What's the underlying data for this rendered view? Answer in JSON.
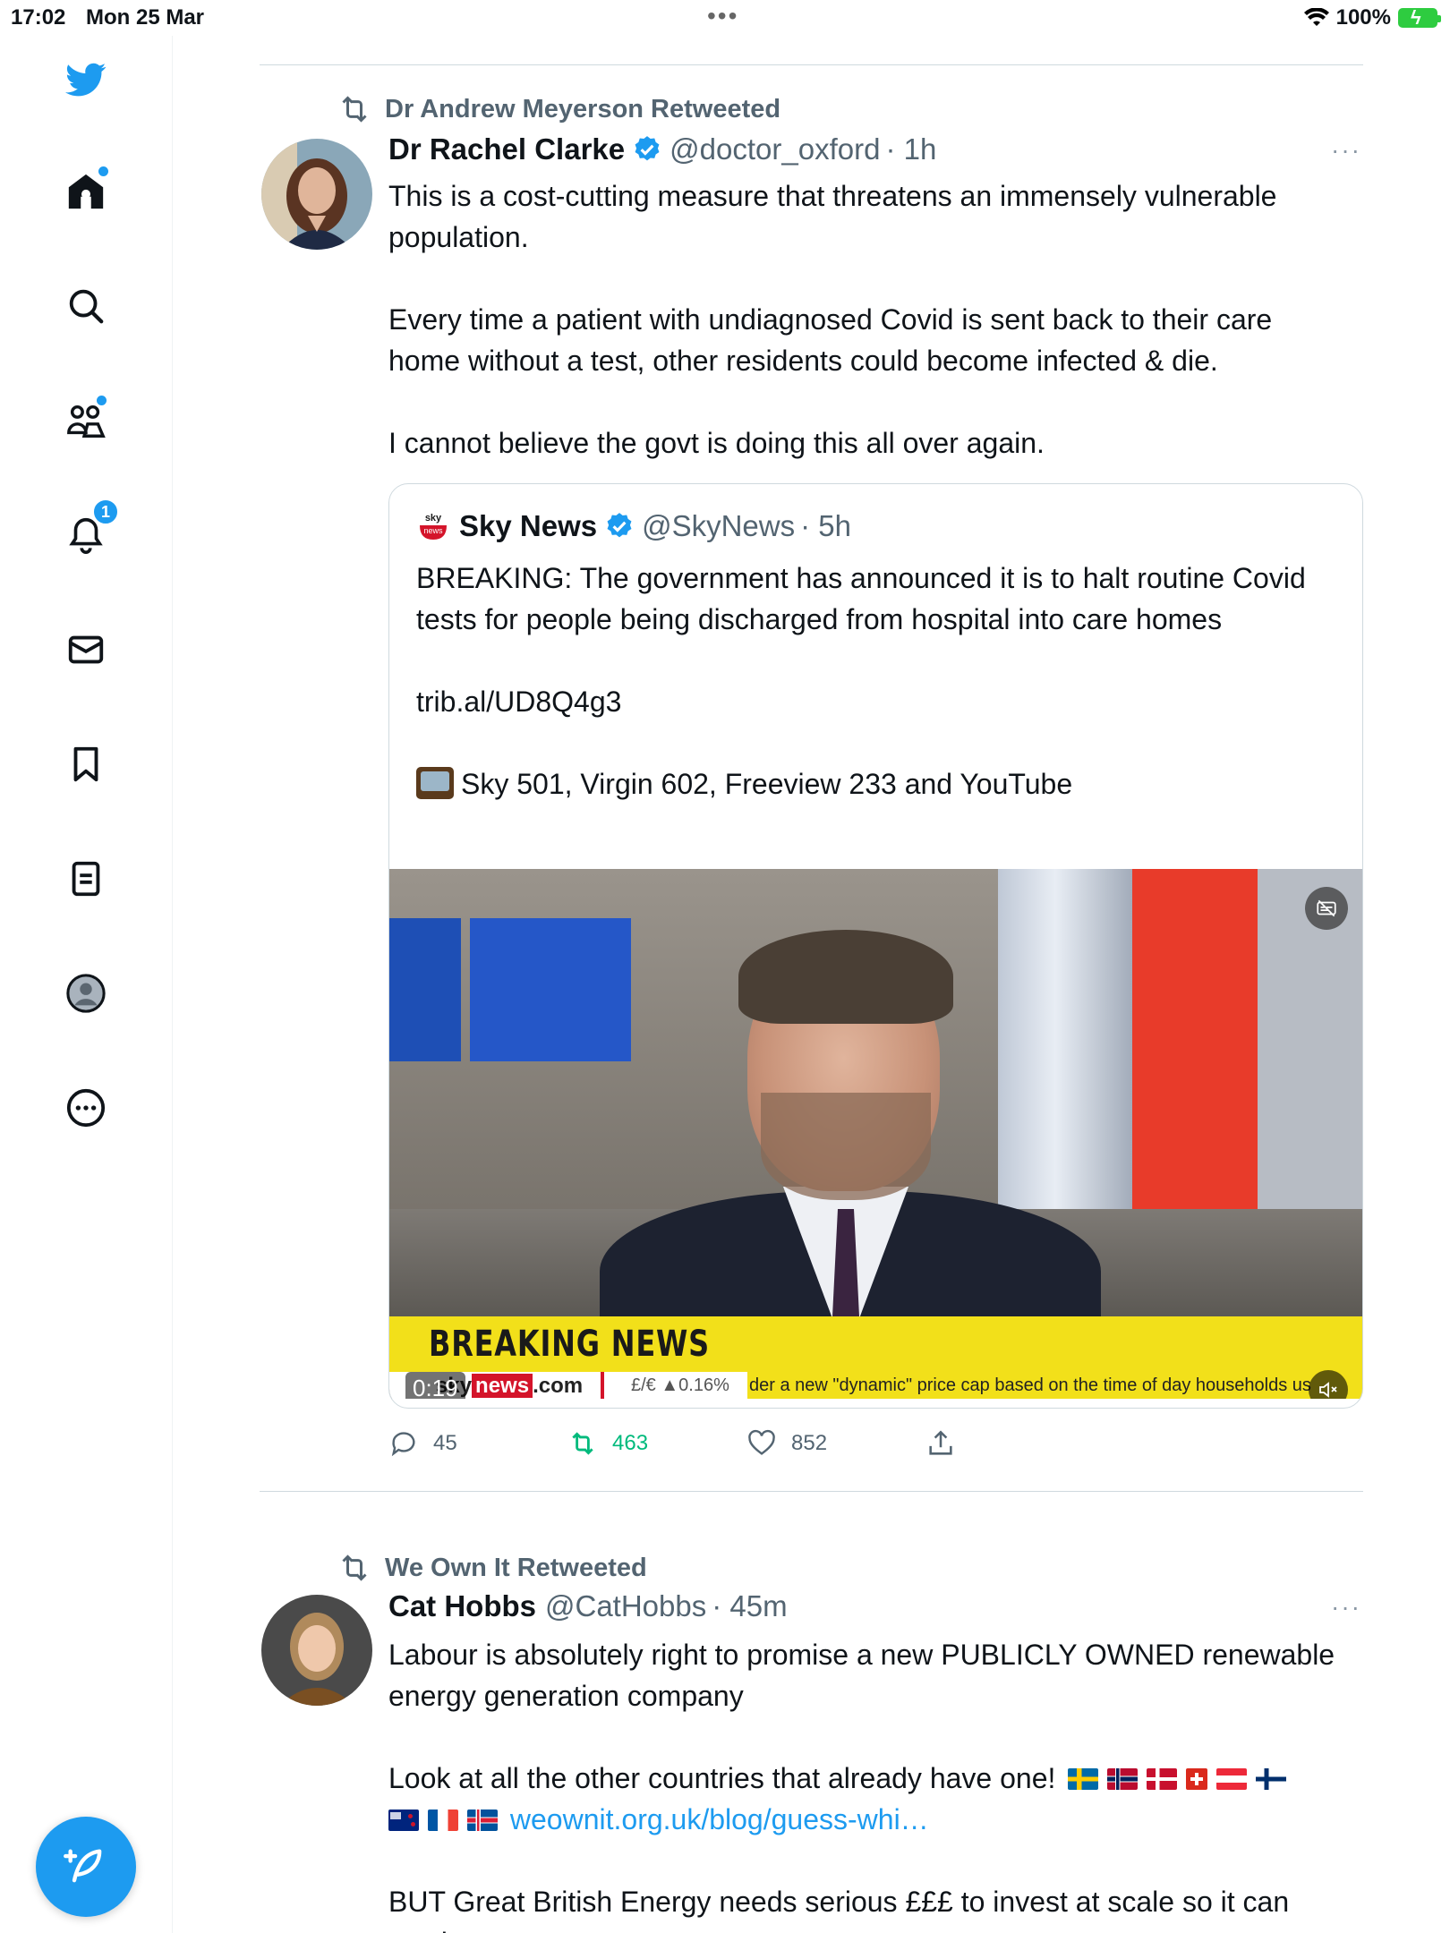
{
  "status_bar": {
    "time": "17:02",
    "date": "Mon 25 Mar",
    "battery": "100%"
  },
  "colors": {
    "brand": "#1d9bf0",
    "retweet_green": "#00ba7c",
    "secondary_text": "#536471"
  },
  "sidebar": {
    "items": [
      {
        "icon": "twitter-bird-icon"
      },
      {
        "icon": "home-icon",
        "has_dot": true
      },
      {
        "icon": "search-icon"
      },
      {
        "icon": "communities-icon",
        "has_dot": true
      },
      {
        "icon": "bell-icon",
        "badge": "1"
      },
      {
        "icon": "mail-icon"
      },
      {
        "icon": "bookmark-icon"
      },
      {
        "icon": "lists-icon"
      },
      {
        "icon": "profile-icon"
      },
      {
        "icon": "more-icon"
      }
    ],
    "compose_icon": "compose-feather-icon"
  },
  "tweet1": {
    "retweeted_by": "Dr Andrew Meyerson Retweeted",
    "name": "Dr Rachel Clarke",
    "handle": "@doctor_oxford",
    "time": "· 1h",
    "more": "···",
    "text": "This is a cost-cutting measure that threatens an immensely vulnerable population.\n\nEvery time a patient with undiagnosed Covid is sent back to their care home without a test, other residents could become infected & die.\n\nI cannot believe the govt is doing this all over again.",
    "quote": {
      "logo_top": "sky",
      "logo_bottom": "news",
      "name": "Sky News",
      "handle": "@SkyNews",
      "time": "· 5h",
      "text": "BREAKING: The government has announced it is to halt routine Covid tests for people being discharged from hospital into care homes\n\ntrib.al/UD8Q4g3\n\n",
      "tv_line": "Sky 501, Virgin 602, Freeview 233 and YouTube",
      "video": {
        "banner": "BREAKING NEWS",
        "ticker_site_prefix": "sky",
        "ticker_site_news": "news",
        "ticker_site_suffix": ".com",
        "ticker_fx": "£/€ ▲0.16%",
        "ticker_story": "der a new \"dynamic\" price cap based on the time of day households us",
        "elapsed": "0:19"
      }
    },
    "actions": {
      "replies": "45",
      "retweets": "463",
      "likes": "852"
    }
  },
  "tweet2": {
    "retweeted_by": "We Own It Retweeted",
    "name": "Cat Hobbs",
    "handle": "@CatHobbs",
    "time": "· 45m",
    "more": "···",
    "text_p1": "Labour is absolutely right to promise a new PUBLICLY OWNED renewable energy generation company",
    "text_p2": "Look at all the other countries that already have one!",
    "link": "weownit.org.uk/blog/guess-whi…",
    "text_p3": "BUT Great British Energy needs serious £££ to invest at scale so it can catch up…",
    "flags": [
      "sweden-flag",
      "norway-flag",
      "denmark-flag",
      "switzerland-flag",
      "austria-flag",
      "finland-flag",
      "new-zealand-flag",
      "france-flag",
      "iceland-flag"
    ]
  }
}
